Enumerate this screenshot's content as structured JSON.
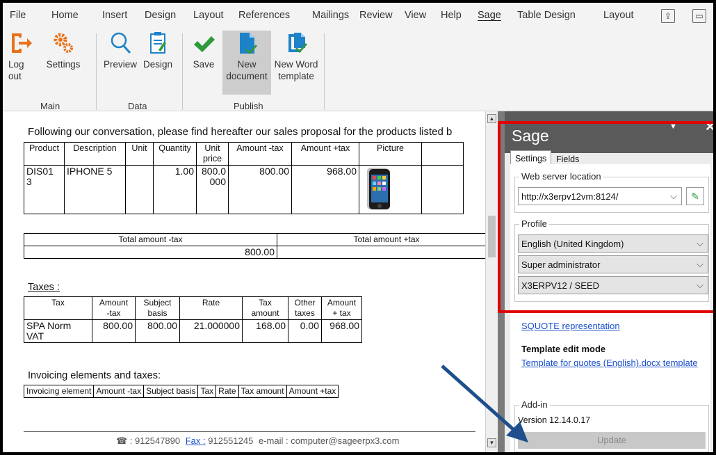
{
  "ribbon": {
    "tabs": [
      "File",
      "Home",
      "Insert",
      "Design",
      "Layout",
      "References",
      "Mailings",
      "Review",
      "View",
      "Help",
      "Sage",
      "Table Design",
      "Layout"
    ],
    "active_tab": "Sage",
    "buttons": {
      "logout": "Log\nout",
      "settings": "Settings",
      "preview": "Preview",
      "design": "Design",
      "save": "Save",
      "new_document": "New\ndocument",
      "new_word_template": "New Word\ntemplate"
    },
    "groups": {
      "main": "Main",
      "data": "Data",
      "publish": "Publish"
    },
    "colors": {
      "accent_orange": "#e8711a",
      "accent_blue": "#1e82c8",
      "accent_green": "#2e9a3a"
    }
  },
  "document": {
    "intro": "Following our conversation, please find hereafter our sales proposal for the products listed b",
    "product_table": {
      "headers": [
        "Product",
        "Description",
        "Unit",
        "Quantity",
        "Unit\nprice",
        "Amount -tax",
        "Amount +tax",
        "Picture"
      ],
      "row": [
        "DIS01\n3",
        "IPHONE 5",
        "",
        "1.00",
        "800.0\n000",
        "800.00",
        "968.00",
        ""
      ]
    },
    "totals": {
      "left_label": "Total amount -tax",
      "right_label": "Total amount +tax",
      "left_value": "800.00"
    },
    "taxes_title": "Taxes :",
    "tax_table": {
      "headers": [
        "Tax",
        "Amount\n-tax",
        "Subject\nbasis",
        "Rate",
        "Tax\namount",
        "Other\ntaxes",
        "Amount\n+ tax"
      ],
      "row": [
        "SPA Norm\nVAT",
        "800.00",
        "800.00",
        "21.000000",
        "168.00",
        "0.00",
        "968.00"
      ]
    },
    "invoicing_title": "Invoicing elements and taxes:",
    "invoicing_headers": [
      "Invoicing element",
      "Amount -tax",
      "Subject basis",
      "Tax",
      "Rate",
      "Tax amount",
      "Amount +tax"
    ],
    "footer": {
      "phone": "☎ : 912547890",
      "fax_label": "Fax :",
      "fax_value": "912551245",
      "email": "e-mail : computer@sageerpx3.com"
    }
  },
  "panel": {
    "title": "Sage",
    "tabs": [
      "Settings",
      "Fields"
    ],
    "web_server_legend": "Web server location",
    "web_server_value": "http://x3erpv12vm:8124/",
    "profile_legend": "Profile",
    "language": "English (United Kingdom)",
    "role": "Super administrator",
    "folder": "X3ERPV12 / SEED",
    "representation_link": "SQUOTE representation",
    "template_mode_title": "Template edit mode",
    "template_link": "Template for quotes (English).docx template",
    "addin_legend": "Add-in",
    "version": "Version 12.14.0.17",
    "update_label": "Update"
  }
}
